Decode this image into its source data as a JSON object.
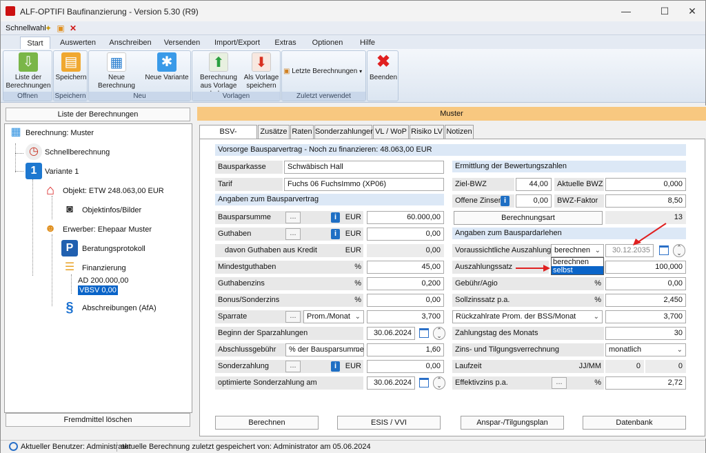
{
  "window": {
    "title": "ALF-OPTIFI Baufinanzierung - Version 5.30 (R9)",
    "minimize": "—",
    "maximize": "☐",
    "close": "✕"
  },
  "quickaccess": {
    "label": "Schnellwahl"
  },
  "ribbon_tabs": [
    "Start",
    "Auswerten",
    "Anschreiben",
    "Versenden",
    "Import/Export",
    "Extras",
    "Optionen",
    "Hilfe"
  ],
  "ribbon": {
    "groups": {
      "offnen": "Offnen",
      "speichern": "Speichern",
      "neu": "Neu",
      "vorlagen": "Vorlagen",
      "zuletzt": "Zuletzt verwendet"
    },
    "liste": "Liste der Berechnungen",
    "speichern_btn": "Speichern",
    "neue_berechnung": "Neue Berechnung",
    "neue_variante": "Neue Variante",
    "laden": "Berechnung aus Vorlage laden",
    "als_vorlage": "Als Vorlage speichern",
    "letzte": "Letzte Berechnungen",
    "beenden": "Beenden"
  },
  "left": {
    "header": "Liste der Berechnungen",
    "tree": {
      "root": "Berechnung: Muster",
      "schnell": "Schnellberechnung",
      "variante": "Variante 1",
      "objekt": "Objekt: ETW 248.063,00 EUR",
      "objektinfos": "Objektinfos/Bilder",
      "erwerber": "Erwerber: Ehepaar Muster",
      "protokoll": "Beratungsprotokoll",
      "finanzierung": "Finanzierung",
      "ad": "AD 200.000,00",
      "vbsv": "VBSV 0,00",
      "afa": "Abschreibungen (AfA)"
    },
    "button": "Fremdmittel löschen"
  },
  "header_bar": "Muster",
  "tabs": [
    "BSV-Hauptmaske",
    "Zusätze",
    "Raten",
    "Sonderzahlungen",
    "VL / WoP",
    "Risiko LV",
    "Notizen"
  ],
  "form": {
    "vorsorge": "Vorsorge Bausparvertrag - Noch zu finanzieren:  48.063,00 EUR",
    "bausparkasse_label": "Bausparkasse",
    "bausparkasse": "Schwäbisch Hall",
    "tarif_label": "Tarif",
    "tarif": "Fuchs 06 FuchsImmo (XP06)",
    "angaben_vertrag": "Angaben zum Bausparvertrag",
    "bausparsumme_label": "Bausparsumme",
    "bausparsumme_unit": "EUR",
    "bausparsumme": "60.000,00",
    "guthaben_label": "Guthaben",
    "guthaben_unit": "EUR",
    "guthaben": "0,00",
    "kredit_label": "davon Guthaben aus Kredit",
    "kredit_unit": "EUR",
    "kredit": "0,00",
    "mindest_label": "Mindestguthaben",
    "mindest_unit": "%",
    "mindest": "45,00",
    "gzins_label": "Guthabenzins",
    "gzins_unit": "%",
    "gzins": "0,200",
    "bonus_label": "Bonus/Sonderzins",
    "bonus_unit": "%",
    "bonus": "0,00",
    "sparrate_label": "Sparrate",
    "sparrate_mode": "Prom./Monat",
    "sparrate": "3,700",
    "beginn_label": "Beginn der Sparzahlungen",
    "beginn": "30.06.2024",
    "abschluss_label": "Abschlussgebühr",
    "abschluss_mode": "% der Bausparsumme",
    "abschluss": "1,60",
    "sonder_label": "Sonderzahlung",
    "sonder_unit": "EUR",
    "sonder": "0,00",
    "opt_label": "optimierte Sonderzahlung am",
    "opt": "30.06.2024",
    "ermittlung": "Ermittlung der Bewertungszahlen",
    "ziel_label": "Ziel-BWZ",
    "ziel": "44,00",
    "aktuell_label": "Aktuelle BWZ",
    "aktuell": "0,000",
    "offene_label": "Offene Zinsen",
    "offene": "0,00",
    "faktor_label": "BWZ-Faktor",
    "faktor": "8,50",
    "berechnungsart": "Berechnungsart",
    "berechnungsart_val": "13",
    "angaben_darlehen": "Angaben zum Bauspardarlehen",
    "auszahlung_label": "Voraussichtliche Auszahlung",
    "auszahlung_mode": "berechnen",
    "auszahlung_date": "30.12.2035",
    "dropdown_options": [
      "berechnen",
      "selbst erfassen"
    ],
    "satz_label": "Auszahlungssatz",
    "satz_unit": "%",
    "satz": "100,000",
    "gebuehr_label": "Gebühr/Agio",
    "gebuehr_unit": "%",
    "gebuehr": "0,00",
    "soll_label": "Sollzinssatz p.a.",
    "soll_unit": "%",
    "soll": "2,450",
    "rueck_label": "Rückzahlrate Prom. der BSS/Monat",
    "rueck": "3,700",
    "zahltag_label": "Zahlungstag des Monats",
    "zahltag": "30",
    "verrechnung_label": "Zins- und Tilgungsverrechnung",
    "verrechnung": "monatlich",
    "laufzeit_label": "Laufzeit",
    "laufzeit_unit": "JJ/MM",
    "laufzeit_jj": "0",
    "laufzeit_mm": "0",
    "eff_label": "Effektivzins p.a.",
    "eff_unit": "%",
    "eff": "2,72"
  },
  "buttons": {
    "berechnen": "Berechnen",
    "esis": "ESIS / VVI",
    "plan": "Anspar-/Tilgungsplan",
    "db": "Datenbank"
  },
  "status": {
    "user": "Aktueller Benutzer: Administrator",
    "saved": "aktuelle Berechnung zuletzt gespeichert von: Administrator am 05.06.2024"
  },
  "colors": {
    "accent": "#f8c880",
    "section": "#dce8f6",
    "highlight": "#0a64c8",
    "arrow": "#e02020"
  }
}
